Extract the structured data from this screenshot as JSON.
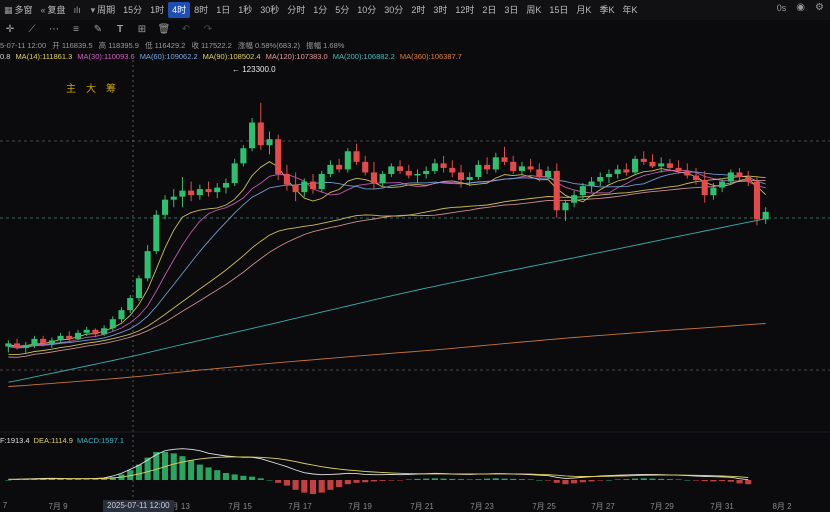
{
  "toolbar": {
    "items": [
      {
        "label": "多窗",
        "icon": "grid-icon"
      },
      {
        "label": "复盘",
        "icon": "rewind-icon"
      },
      {
        "label": "",
        "icon": "chart-type-icon"
      },
      {
        "label": "周期",
        "icon": "period-icon"
      },
      {
        "label": "15分"
      },
      {
        "label": "1时"
      },
      {
        "label": "4时",
        "active": true
      },
      {
        "label": "8时"
      },
      {
        "label": "1日"
      },
      {
        "label": "1秒"
      },
      {
        "label": "30秒"
      },
      {
        "label": "分时"
      },
      {
        "label": "1分"
      },
      {
        "label": "5分"
      },
      {
        "label": "10分"
      },
      {
        "label": "30分"
      },
      {
        "label": "2时"
      },
      {
        "label": "3时"
      },
      {
        "label": "12时"
      },
      {
        "label": "2日"
      },
      {
        "label": "3日"
      },
      {
        "label": "周K"
      },
      {
        "label": "15日"
      },
      {
        "label": "月K"
      },
      {
        "label": "季K"
      },
      {
        "label": "年K"
      }
    ],
    "right_time": "0s"
  },
  "ohlc_row": {
    "time": "5-07-11 12:00",
    "open": "开 116839.5",
    "high": "高 118395.9",
    "low": "低 116429.2",
    "close": "收 117522.2",
    "change": "涨幅 0.58%(683.2)",
    "amplitude": "振幅 1.68%"
  },
  "ma_row": [
    {
      "label": "0.8",
      "color": "#d0d0d0"
    },
    {
      "label": "MA(14):111861.3",
      "color": "#e0d060"
    },
    {
      "label": "MA(30):110093.6",
      "color": "#d060c0"
    },
    {
      "label": "MA(60):109062.2",
      "color": "#7aa8e0"
    },
    {
      "label": "MA(90):108502.4",
      "color": "#e0d060"
    },
    {
      "label": "MA(120):107383.0",
      "color": "#e09a9a"
    },
    {
      "label": "MA(200):106882.2",
      "color": "#40c0c0"
    },
    {
      "label": "MA(360):106387.7",
      "color": "#e08040"
    }
  ],
  "indicator_labels": [
    "主",
    "大",
    "筹"
  ],
  "high_marker": "← 123300.0",
  "macd_row": [
    {
      "label": "F:1913.4",
      "color": "#e0e0e0"
    },
    {
      "label": "DEA:1114.9",
      "color": "#e0d060"
    },
    {
      "label": "MACD:1597.1",
      "color": "#40b0c0"
    }
  ],
  "time_axis": [
    "7",
    "7月 9",
    "7月 13",
    "7月 15",
    "7月 17",
    "7月 19",
    "7月 21",
    "7月 23",
    "7月 25",
    "7月 27",
    "7月 29",
    "7月 31",
    "8月 2"
  ],
  "crosshair_time": "2025-07-11 12:00",
  "colors": {
    "up": "#2fbf71",
    "down": "#e54a4a",
    "active_tab": "#1f4fb3",
    "background": "#0b0b0d"
  },
  "chart_data": {
    "type": "candlestick",
    "price_ylim": [
      103000,
      126000
    ],
    "candles": [
      [
        107200,
        107600,
        106800,
        107400
      ],
      [
        107400,
        107700,
        107000,
        107100
      ],
      [
        107100,
        107500,
        106700,
        107300
      ],
      [
        107300,
        107900,
        107100,
        107700
      ],
      [
        107700,
        107900,
        107200,
        107400
      ],
      [
        107400,
        107800,
        107100,
        107600
      ],
      [
        107600,
        108100,
        107400,
        107900
      ],
      [
        107900,
        108200,
        107500,
        107700
      ],
      [
        107700,
        108300,
        107600,
        108100
      ],
      [
        108100,
        108500,
        107900,
        108300
      ],
      [
        108300,
        108400,
        107800,
        108000
      ],
      [
        108000,
        108600,
        107900,
        108400
      ],
      [
        108400,
        109200,
        108200,
        109000
      ],
      [
        109000,
        109800,
        108800,
        109600
      ],
      [
        109600,
        110600,
        109400,
        110400
      ],
      [
        110400,
        111900,
        110200,
        111700
      ],
      [
        111700,
        113900,
        111500,
        113500
      ],
      [
        113500,
        116200,
        113300,
        115900
      ],
      [
        115900,
        117200,
        115600,
        116900
      ],
      [
        116900,
        117600,
        116400,
        117100
      ],
      [
        117100,
        118400,
        116400,
        117500
      ],
      [
        117500,
        118100,
        116800,
        117200
      ],
      [
        117200,
        117900,
        116900,
        117600
      ],
      [
        117600,
        118100,
        117100,
        117400
      ],
      [
        117400,
        118000,
        117000,
        117700
      ],
      [
        117700,
        118300,
        117300,
        118000
      ],
      [
        118000,
        119600,
        117800,
        119300
      ],
      [
        119300,
        120500,
        119100,
        120300
      ],
      [
        120300,
        122300,
        120100,
        122000
      ],
      [
        122000,
        123300,
        120200,
        120500
      ],
      [
        120500,
        121400,
        119900,
        120900
      ],
      [
        120900,
        121200,
        118200,
        118600
      ],
      [
        118600,
        119200,
        117500,
        117900
      ],
      [
        117900,
        118700,
        116800,
        117400
      ],
      [
        117400,
        118300,
        117100,
        118100
      ],
      [
        118100,
        118600,
        117300,
        117600
      ],
      [
        117600,
        118800,
        117400,
        118600
      ],
      [
        118600,
        119500,
        118400,
        119200
      ],
      [
        119200,
        119600,
        118700,
        118900
      ],
      [
        118900,
        120300,
        118700,
        120100
      ],
      [
        120100,
        120600,
        119200,
        119400
      ],
      [
        119400,
        119800,
        118500,
        118700
      ],
      [
        118700,
        119400,
        117600,
        118000
      ],
      [
        118000,
        118800,
        117800,
        118600
      ],
      [
        118600,
        119300,
        118400,
        119100
      ],
      [
        119100,
        119500,
        118600,
        118800
      ],
      [
        118800,
        119200,
        118300,
        118500
      ],
      [
        118500,
        118900,
        118000,
        118600
      ],
      [
        118600,
        119100,
        118300,
        118800
      ],
      [
        118800,
        119600,
        118600,
        119300
      ],
      [
        119300,
        119800,
        118700,
        119000
      ],
      [
        119000,
        119500,
        118400,
        118700
      ],
      [
        118700,
        119200,
        117700,
        118200
      ],
      [
        118200,
        118700,
        117800,
        118400
      ],
      [
        118400,
        119500,
        118200,
        119200
      ],
      [
        119200,
        119700,
        118600,
        118900
      ],
      [
        118900,
        120000,
        118700,
        119700
      ],
      [
        119700,
        120400,
        119200,
        119400
      ],
      [
        119400,
        119800,
        118600,
        118800
      ],
      [
        118800,
        119400,
        118500,
        119100
      ],
      [
        119100,
        119600,
        118700,
        118900
      ],
      [
        118900,
        119300,
        118100,
        118400
      ],
      [
        118400,
        119100,
        118200,
        118800
      ],
      [
        118800,
        119300,
        115700,
        116200
      ],
      [
        116200,
        116900,
        115500,
        116700
      ],
      [
        116700,
        117500,
        116400,
        117200
      ],
      [
        117200,
        118000,
        116900,
        117800
      ],
      [
        117800,
        118400,
        117400,
        118100
      ],
      [
        118100,
        118700,
        117800,
        118400
      ],
      [
        118400,
        118900,
        118000,
        118600
      ],
      [
        118600,
        119200,
        118300,
        118900
      ],
      [
        118900,
        119300,
        118500,
        118700
      ],
      [
        118700,
        119800,
        118500,
        119600
      ],
      [
        119600,
        120100,
        119200,
        119400
      ],
      [
        119400,
        119900,
        119000,
        119100
      ],
      [
        119100,
        119700,
        118700,
        119300
      ],
      [
        119300,
        119600,
        118800,
        119000
      ],
      [
        119000,
        119500,
        118600,
        118800
      ],
      [
        118800,
        119300,
        118300,
        118500
      ],
      [
        118500,
        119000,
        117900,
        118200
      ],
      [
        118200,
        118800,
        116700,
        117200
      ],
      [
        117200,
        118000,
        116900,
        117700
      ],
      [
        117700,
        118300,
        117400,
        118100
      ],
      [
        118100,
        118900,
        117900,
        118700
      ],
      [
        118700,
        119000,
        118200,
        118400
      ],
      [
        118400,
        118800,
        117800,
        118100
      ],
      [
        118100,
        118400,
        115200,
        115600
      ],
      [
        115600,
        116400,
        115300,
        116100
      ]
    ],
    "ma": [
      {
        "name": "MA(14)",
        "color": "#e0d060",
        "start": 106900,
        "end": 118300
      },
      {
        "name": "MA(30)",
        "color": "#d060c0",
        "start": 106500,
        "end": 118600
      },
      {
        "name": "MA(60)",
        "color": "#7aa8e0",
        "start": 106100,
        "end": 118900
      },
      {
        "name": "MA(90)",
        "color": "#e0d060",
        "start": 105800,
        "end": 118600
      },
      {
        "name": "MA(120)",
        "color": "#e09a9a",
        "start": 105400,
        "end": 118000
      },
      {
        "name": "MA(200)",
        "color": "#40c0c0",
        "start": 104700,
        "end": 115500
      },
      {
        "name": "MA(360)",
        "color": "#e08040",
        "start": 104400,
        "end": 108200
      }
    ],
    "macd_hist": [
      0,
      0.02,
      0.04,
      0.03,
      0.05,
      0.06,
      0.05,
      0.04,
      0.03,
      0.02,
      0.03,
      0.04,
      0.1,
      0.2,
      0.35,
      0.55,
      0.8,
      1.0,
      1.0,
      0.95,
      0.85,
      0.7,
      0.55,
      0.45,
      0.35,
      0.25,
      0.2,
      0.15,
      0.12,
      0.06,
      0.0,
      -0.1,
      -0.2,
      -0.35,
      -0.45,
      -0.5,
      -0.45,
      -0.35,
      -0.25,
      -0.15,
      -0.1,
      -0.08,
      -0.05,
      -0.03,
      -0.02,
      -0.01,
      0.02,
      0.04,
      0.05,
      0.06,
      0.05,
      0.04,
      0.03,
      0.02,
      0.03,
      0.05,
      0.06,
      0.05,
      0.04,
      0.03,
      0.02,
      0.0,
      -0.02,
      -0.1,
      -0.15,
      -0.12,
      -0.08,
      -0.05,
      -0.02,
      0.0,
      0.02,
      0.03,
      0.05,
      0.06,
      0.05,
      0.04,
      0.03,
      0.02,
      0.0,
      -0.02,
      -0.04,
      -0.05,
      -0.04,
      -0.06,
      -0.12,
      -0.15
    ],
    "macd_dif": [
      0.05,
      0.06,
      0.08,
      0.1,
      0.12,
      0.13,
      0.12,
      0.1,
      0.1,
      0.1,
      0.12,
      0.15,
      0.3,
      0.5,
      0.8,
      1.1,
      1.5,
      1.9,
      2.2,
      2.3,
      2.35,
      2.3,
      2.2,
      2.0,
      1.9,
      1.8,
      1.75,
      1.7,
      1.7,
      1.6,
      1.4,
      1.2,
      1.0,
      0.75,
      0.55,
      0.45,
      0.4,
      0.42,
      0.45,
      0.5,
      0.48,
      0.42,
      0.4,
      0.4,
      0.42,
      0.4,
      0.42,
      0.45,
      0.47,
      0.5,
      0.48,
      0.45,
      0.43,
      0.42,
      0.44,
      0.46,
      0.48,
      0.47,
      0.45,
      0.43,
      0.4,
      0.36,
      0.33,
      0.2,
      0.12,
      0.15,
      0.2,
      0.25,
      0.3,
      0.33,
      0.36,
      0.38,
      0.4,
      0.42,
      0.42,
      0.4,
      0.38,
      0.36,
      0.33,
      0.3,
      0.27,
      0.25,
      0.23,
      0.2,
      0.1,
      0.02
    ],
    "macd_dea": [
      0.05,
      0.05,
      0.06,
      0.07,
      0.08,
      0.09,
      0.1,
      0.1,
      0.1,
      0.1,
      0.1,
      0.11,
      0.15,
      0.22,
      0.32,
      0.45,
      0.62,
      0.8,
      1.0,
      1.2,
      1.35,
      1.48,
      1.58,
      1.65,
      1.7,
      1.72,
      1.73,
      1.73,
      1.72,
      1.7,
      1.66,
      1.6,
      1.5,
      1.38,
      1.24,
      1.12,
      1.0,
      0.9,
      0.82,
      0.75,
      0.7,
      0.64,
      0.6,
      0.56,
      0.53,
      0.5,
      0.48,
      0.47,
      0.46,
      0.46,
      0.46,
      0.46,
      0.45,
      0.45,
      0.45,
      0.45,
      0.46,
      0.46,
      0.46,
      0.45,
      0.44,
      0.42,
      0.4,
      0.36,
      0.31,
      0.28,
      0.26,
      0.26,
      0.27,
      0.28,
      0.3,
      0.31,
      0.33,
      0.35,
      0.36,
      0.37,
      0.37,
      0.37,
      0.36,
      0.35,
      0.34,
      0.32,
      0.3,
      0.28,
      0.24,
      0.19
    ]
  }
}
